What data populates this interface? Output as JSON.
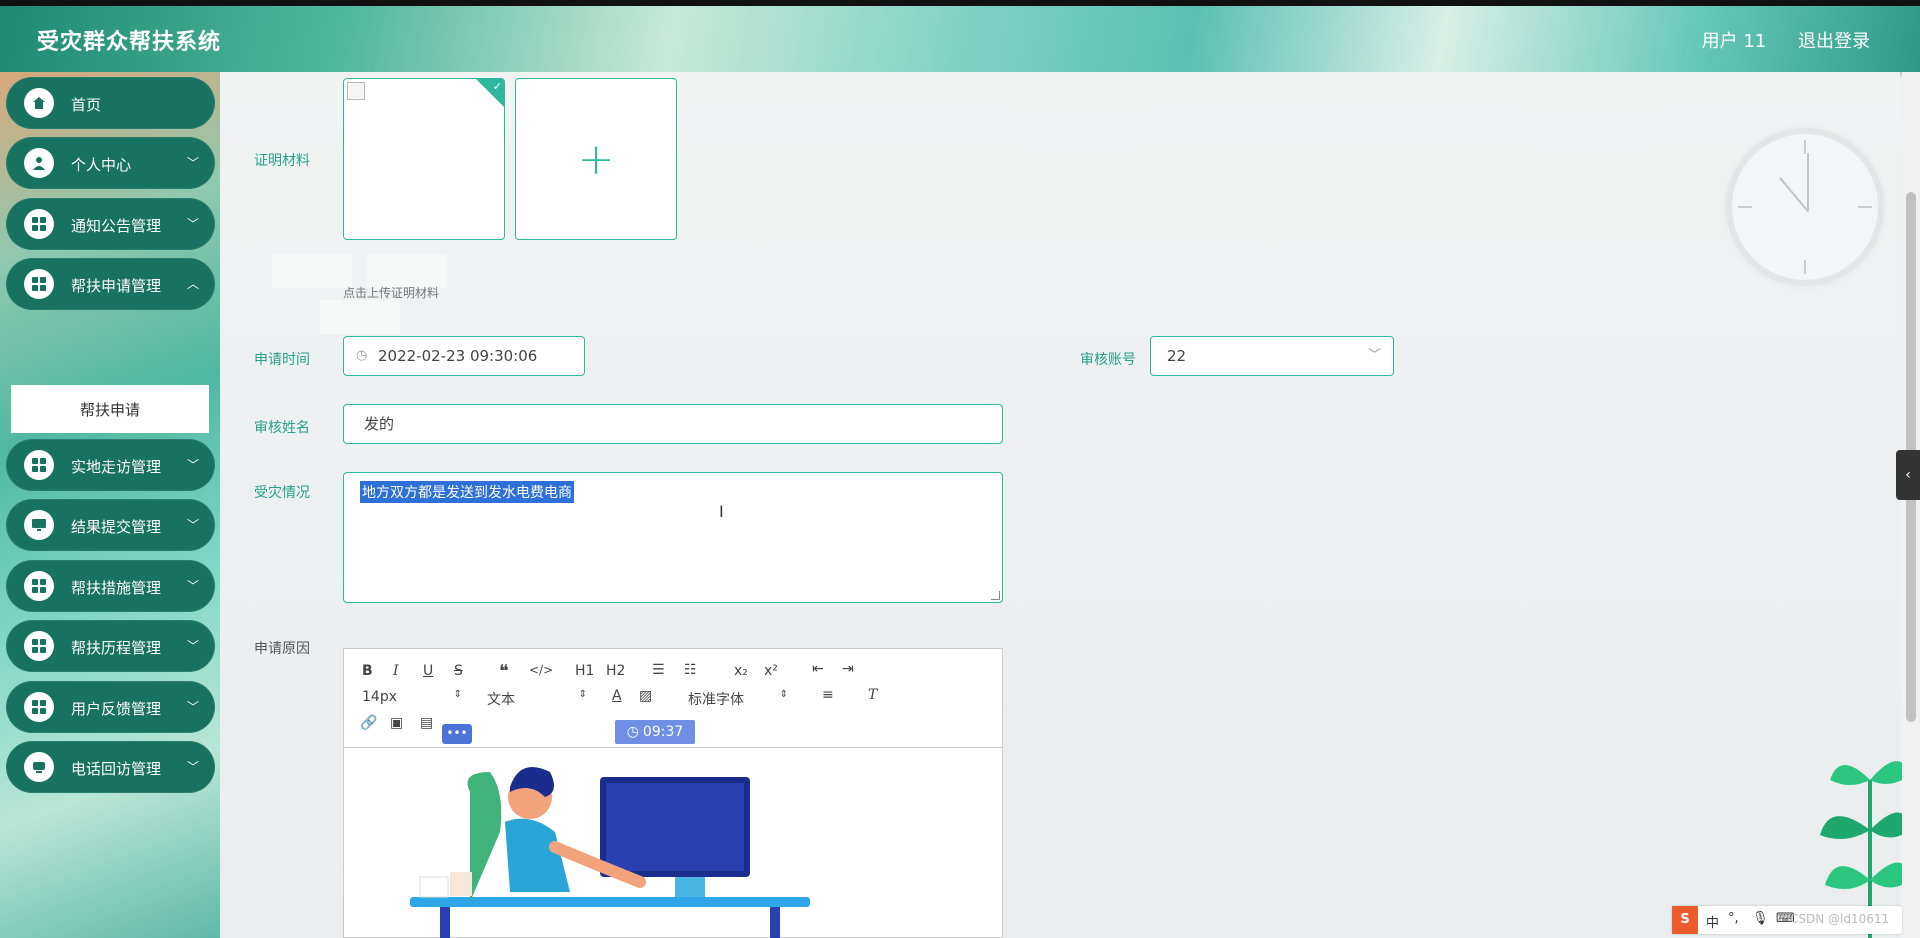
{
  "header": {
    "title": "受灾群众帮扶系统",
    "user": "用户 11",
    "logout": "退出登录"
  },
  "sidebar": {
    "items": [
      {
        "label": "首页",
        "icon": "home-icon"
      },
      {
        "label": "个人中心",
        "icon": "user-icon"
      },
      {
        "label": "通知公告管理",
        "icon": "grid-icon"
      },
      {
        "label": "帮扶申请管理",
        "icon": "grid-icon"
      },
      {
        "label": "实地走访管理",
        "icon": "grid-icon"
      },
      {
        "label": "结果提交管理",
        "icon": "monitor-icon"
      },
      {
        "label": "帮扶措施管理",
        "icon": "grid-icon"
      },
      {
        "label": "帮扶历程管理",
        "icon": "grid-icon"
      },
      {
        "label": "用户反馈管理",
        "icon": "grid-icon"
      },
      {
        "label": "电话回访管理",
        "icon": "phone-icon"
      }
    ],
    "submenu_active": "帮扶申请"
  },
  "form": {
    "proof_label": "证明材料",
    "upload_hint": "点击上传证明材料",
    "apply_time_label": "申请时间",
    "apply_time_value": "2022-02-23 09:30:06",
    "review_account_label": "审核账号",
    "review_account_value": "22",
    "review_name_label": "审核姓名",
    "review_name_value": "发的",
    "disaster_label": "受灾情况",
    "disaster_value": "地方双方都是发送到发水电费电商",
    "reason_label": "申请原因"
  },
  "editor": {
    "font_size": "14px",
    "block_type": "文本",
    "font_family": "标准字体",
    "buttons": [
      "B",
      "I",
      "U",
      "S",
      "❝",
      "</>",
      "H1",
      "H2",
      "ol",
      "ul",
      "x₂",
      "x²",
      "outdent",
      "indent"
    ],
    "time_badge": "09:37",
    "dots": "•••"
  },
  "colors": {
    "accent": "#2fb99c",
    "sidebar_item": "#187260",
    "selection": "#2f70d6"
  },
  "ime": {
    "logo": "S",
    "lang": "中"
  },
  "watermark": "CSDN @ld10611"
}
